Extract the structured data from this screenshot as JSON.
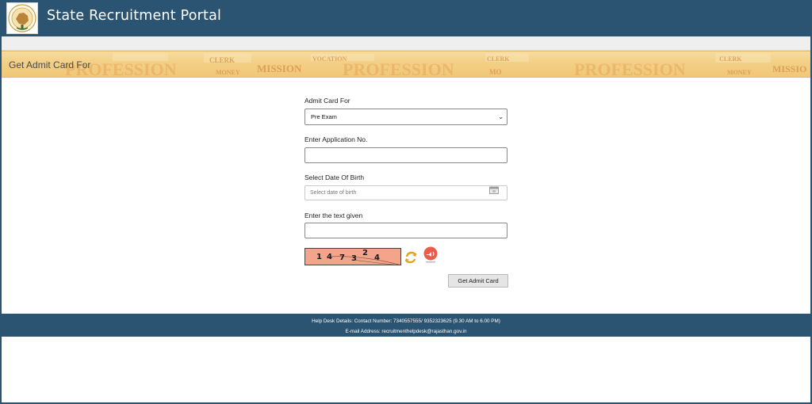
{
  "header": {
    "title": "State Recruitment Portal",
    "logo_icon": "rajasthan-emblem-icon"
  },
  "banner": {
    "title": "Get Admit Card For"
  },
  "form": {
    "admit_card_for": {
      "label": "Admit Card For",
      "selected": "Pre Exam"
    },
    "application_no": {
      "label": "Enter Application No.",
      "value": ""
    },
    "dob": {
      "label": "Select Date Of Birth",
      "placeholder": "Select date of birth"
    },
    "captcha_text": {
      "label": "Enter the text given",
      "value": ""
    },
    "captcha": {
      "digits": [
        "1",
        "4",
        "7",
        "3",
        "2",
        "4"
      ],
      "background": "#f3a58c"
    },
    "submit_label": "Get Admit Card"
  },
  "footer": {
    "helpdesk": "Help Desk Details: Contact Number: 7340557555/ 9352323625 (9.30 AM to 6.00 PM)",
    "email": "E-mail Address: recruitmenthelpdesk@rajasthan.gov.in"
  },
  "colors": {
    "header_bg": "#2b5472",
    "banner_bg": "#f3cf86"
  }
}
